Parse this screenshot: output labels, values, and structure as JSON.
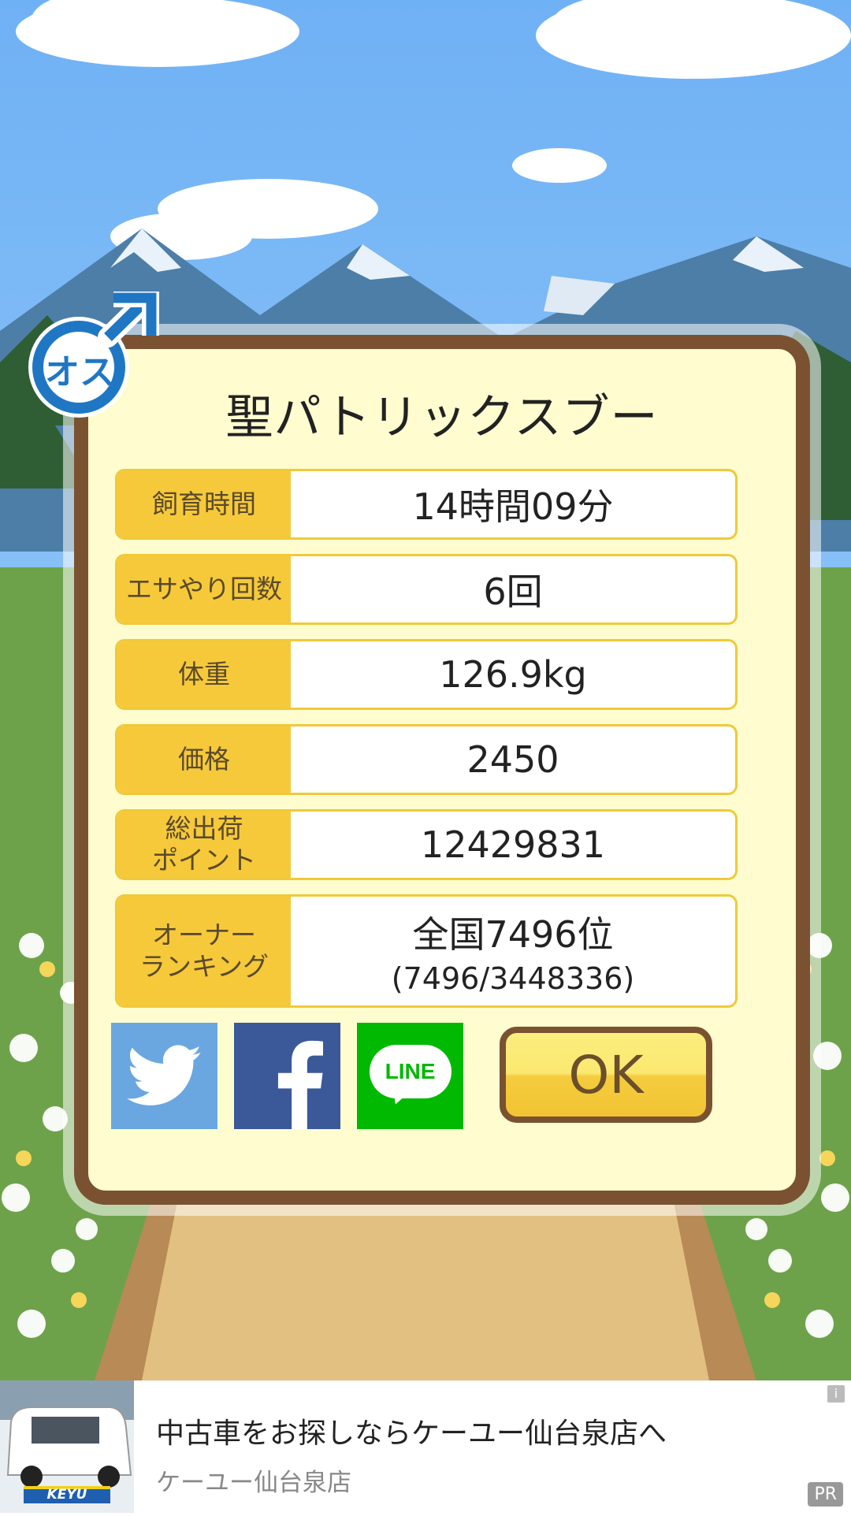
{
  "pig": {
    "name": "聖パトリックスブー",
    "gender_badge_text": "オス"
  },
  "stats": [
    {
      "label": "飼育時間",
      "value": "14時間09分"
    },
    {
      "label": "エサやり回数",
      "value": "6回"
    },
    {
      "label": "体重",
      "value": "126.9kg"
    },
    {
      "label": "価格",
      "value": "2450"
    },
    {
      "label": "総出荷\nポイント",
      "value": "12429831"
    },
    {
      "label": "オーナー\nランキング",
      "value": "全国7496位",
      "sub": "(7496/3448336)"
    }
  ],
  "share": {
    "twitter_icon": "twitter-icon",
    "facebook_icon": "facebook-icon",
    "line_label": "LINE"
  },
  "ok_label": "OK",
  "ad": {
    "headline": "中古車をお探しならケーユー仙台泉店へ",
    "advertiser": "ケーユー仙台泉店",
    "logo_text": "KEYU",
    "pr_label": "PR",
    "info_label": "i"
  },
  "colors": {
    "dialog_border": "#7a5231",
    "dialog_bg": "#fffdd0",
    "label_bg": "#f6c93a",
    "twitter": "#6aa7e0",
    "facebook": "#3b5998",
    "line": "#00b900",
    "badge_blue": "#1f77c4"
  }
}
